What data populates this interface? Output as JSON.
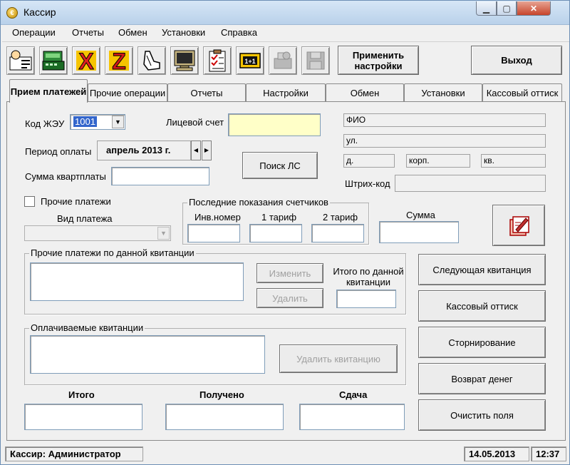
{
  "window": {
    "title": "Кассир",
    "icon_letter": "€"
  },
  "menu": [
    "Операции",
    "Отчеты",
    "Обмен",
    "Установки",
    "Справка"
  ],
  "toolbar": {
    "icons": [
      "cashier-icon",
      "cash-register-icon",
      "x-report-icon",
      "z-report-icon",
      "hand-pointer-icon",
      "monitor-icon",
      "clipboard-checklist-icon",
      "calculator-icon",
      "printer-disabled-icon",
      "floppy-disk-disabled-icon"
    ],
    "x_letter": "X",
    "z_letter": "Z",
    "calc_text": "1+1",
    "apply_label": "Применить настройки",
    "exit_label": "Выход"
  },
  "tabs": [
    "Прием платежей",
    "Прочие операции",
    "Отчеты",
    "Настройки",
    "Обмен",
    "Установки",
    "Кассовый оттиск"
  ],
  "form": {
    "code_label": "Код ЖЭУ",
    "code_value": "1001",
    "account_label": "Лицевой счет",
    "account_value": "",
    "period_label": "Период оплаты",
    "period_value": "апрель 2013 г.",
    "rent_label": "Сумма квартплаты",
    "search_btn": "Поиск ЛС",
    "fio": "ФИО",
    "street": "ул.",
    "house": "д.",
    "building": "корп.",
    "apartment": "кв.",
    "barcode_label": "Штрих-код",
    "other_payments_label": "Прочие платежи",
    "payment_type_label": "Вид платежа",
    "meters_group": "Последние показания счетчиков",
    "inv_label": "Инв.номер",
    "tariff1_label": "1 тариф",
    "tariff2_label": "2 тариф",
    "sum_label": "Сумма",
    "other_group": "Прочие платежи по данной квитанции",
    "edit_btn": "Изменить",
    "delete_btn": "Удалить",
    "total_receipt_label": "Итого по данной квитанции",
    "paid_group": "Оплачиваемые квитанции",
    "delete_receipt_btn": "Удалить квитанцию",
    "total_label": "Итого",
    "received_label": "Получено",
    "change_label": "Сдача"
  },
  "actions": {
    "next": "Следующая квитанция",
    "imprint": "Кассовый оттиск",
    "storno": "Сторнирование",
    "refund": "Возврат денег",
    "clear": "Очистить поля"
  },
  "status": {
    "user": "Кассир: Администратор",
    "date": "14.05.2013",
    "time": "12:37"
  },
  "colors": {
    "account_field": "#ffffc8",
    "selection": "#3366cc",
    "x_red": "#e02020",
    "z_red": "#d01818"
  }
}
